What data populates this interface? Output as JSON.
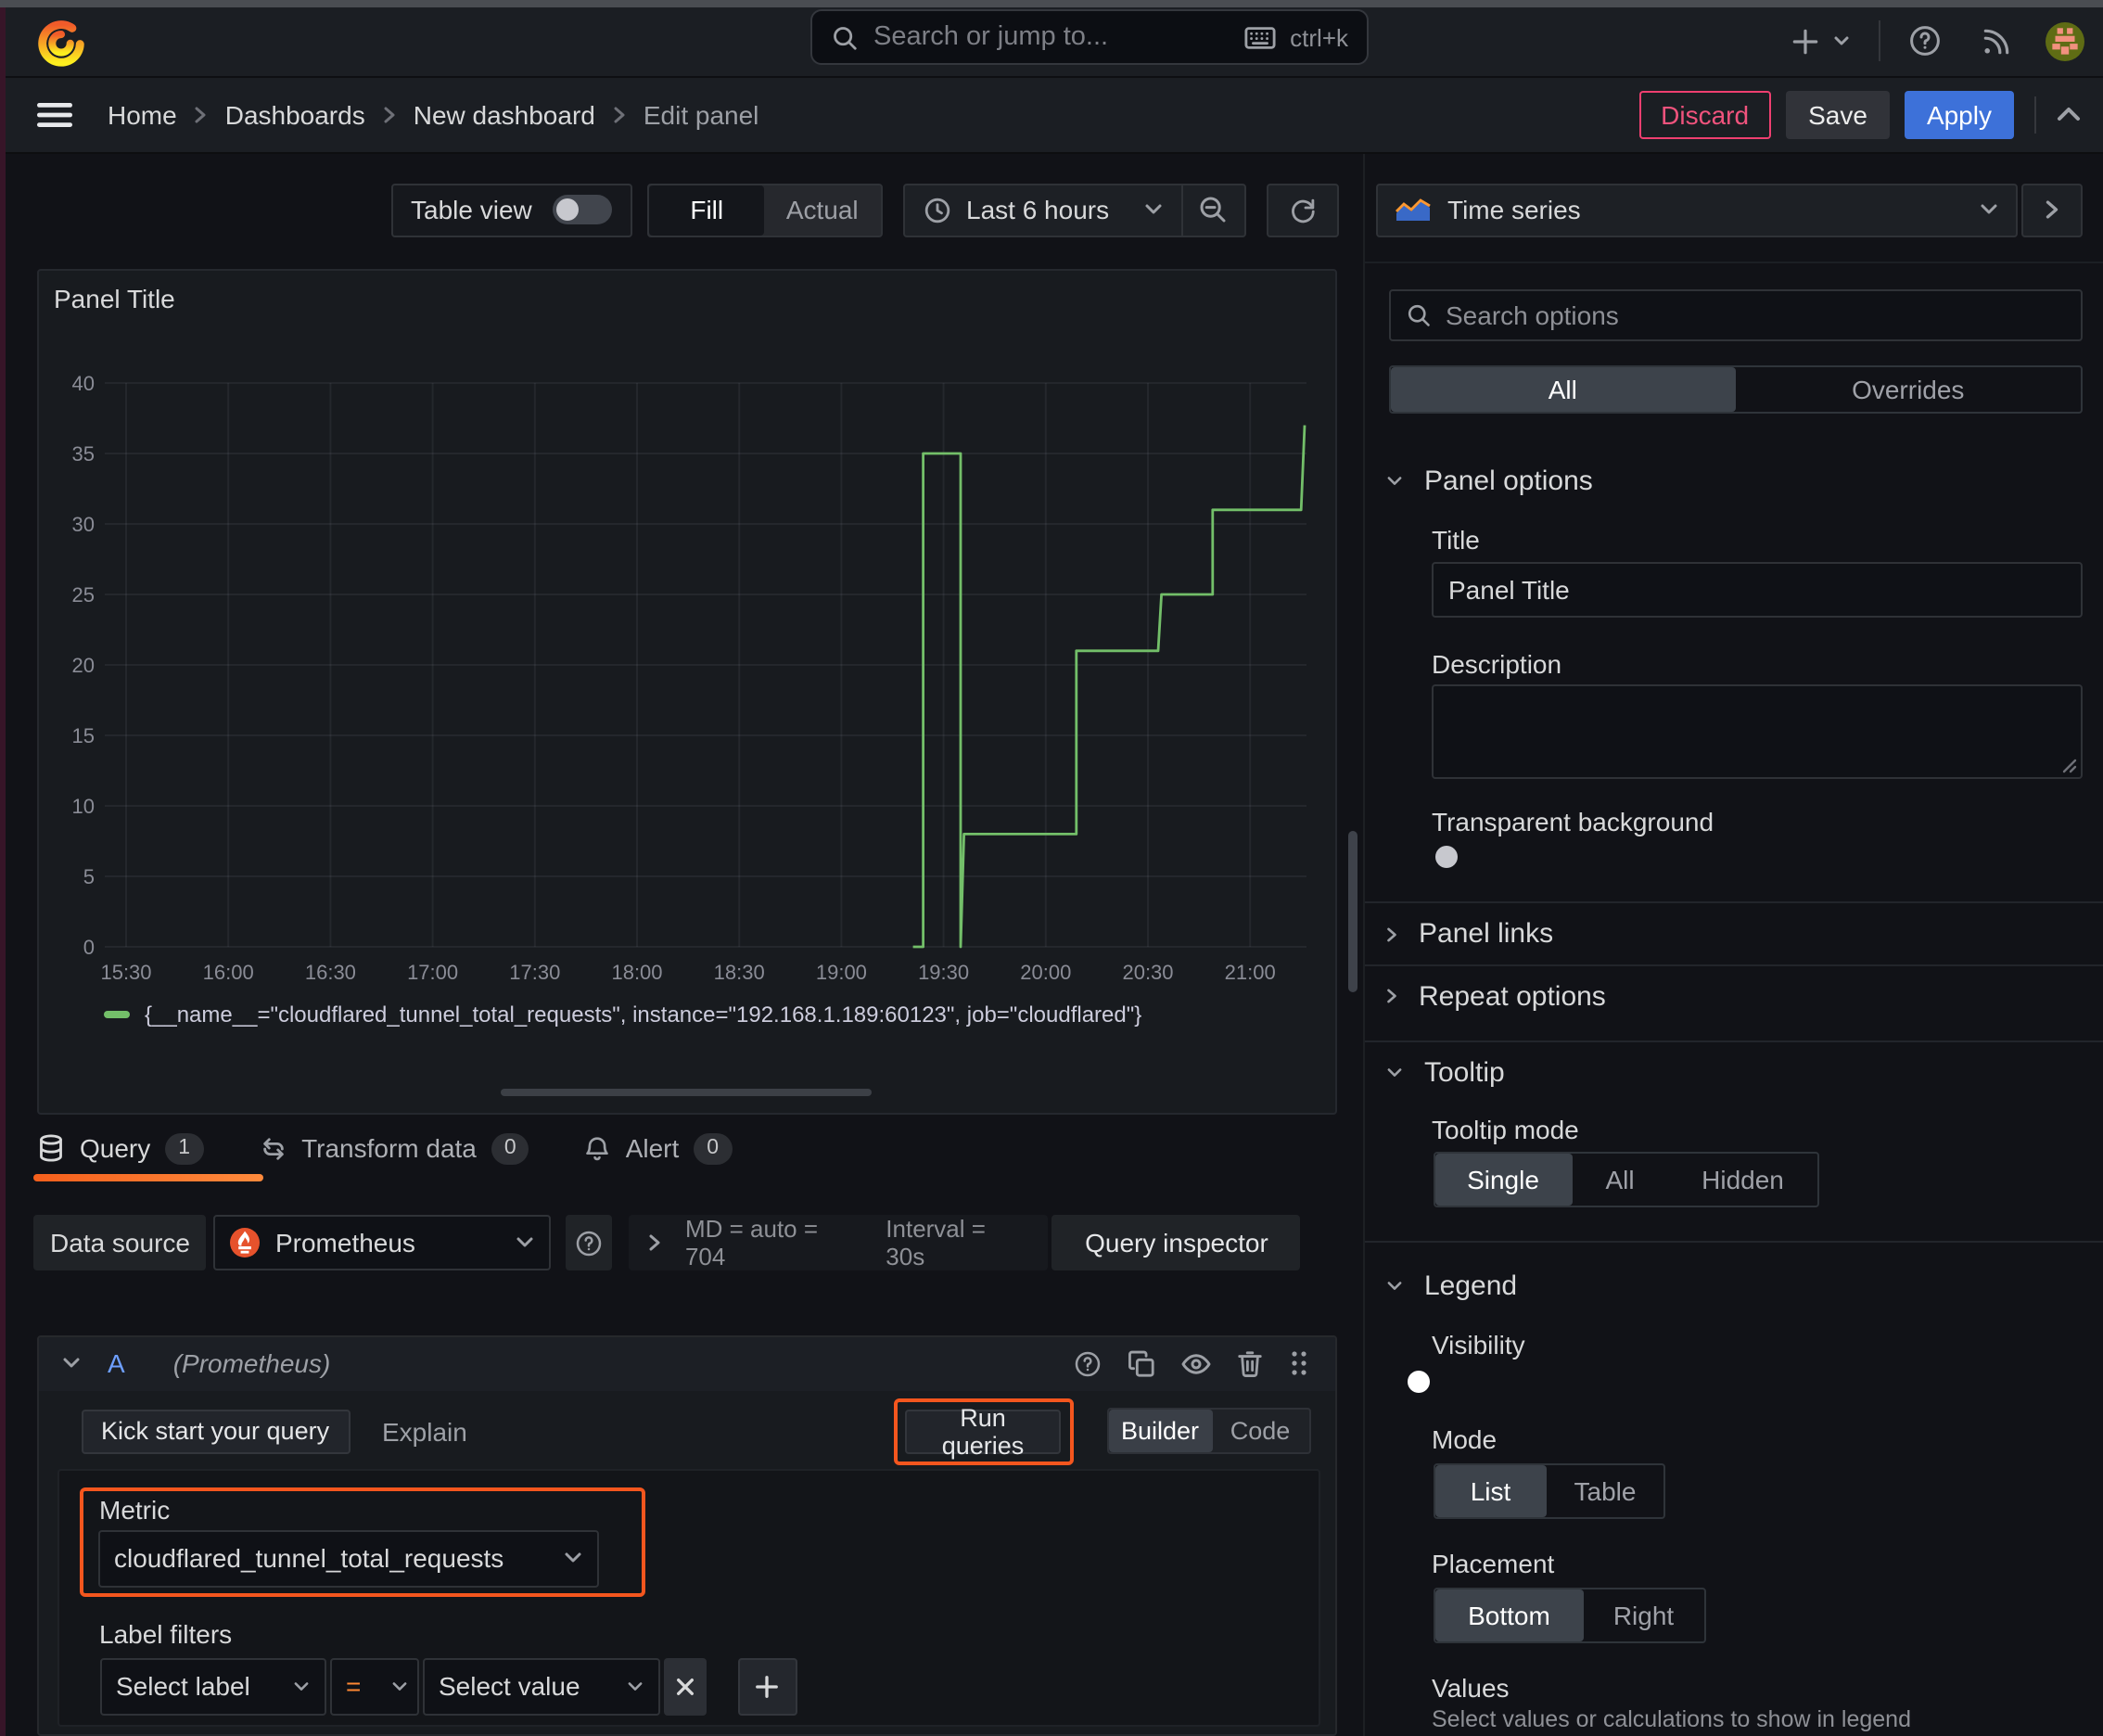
{
  "topbar": {
    "search_placeholder": "Search or jump to...",
    "search_shortcut": "ctrl+k"
  },
  "breadcrumb": {
    "items": [
      "Home",
      "Dashboards",
      "New dashboard",
      "Edit panel"
    ]
  },
  "actions": {
    "discard": "Discard",
    "save": "Save",
    "apply": "Apply"
  },
  "toolbar": {
    "table_view_label": "Table view",
    "fill_label": "Fill",
    "actual_label": "Actual",
    "time_range": "Last 6 hours"
  },
  "panel": {
    "title": "Panel Title"
  },
  "chart_data": {
    "type": "line",
    "title": "Panel Title",
    "xlabel": "",
    "ylabel": "",
    "ylim": [
      0,
      40
    ],
    "grid": true,
    "legend_position": "bottom",
    "x_ticks": [
      "15:30",
      "16:00",
      "16:30",
      "17:00",
      "17:30",
      "18:00",
      "18:30",
      "19:00",
      "19:30",
      "20:00",
      "20:30",
      "21:00"
    ],
    "y_ticks": [
      0,
      5,
      10,
      15,
      20,
      25,
      30,
      35,
      40
    ],
    "series": [
      {
        "name": "{__name__=\"cloudflared_tunnel_total_requests\", instance=\"192.168.1.189:60123\", job=\"cloudflared\"}",
        "color": "#73bf69",
        "points": [
          [
            "19:21",
            0
          ],
          [
            "19:24",
            0
          ],
          [
            "19:24",
            35
          ],
          [
            "19:35",
            35
          ],
          [
            "19:35",
            0
          ],
          [
            "19:36",
            8
          ],
          [
            "20:09",
            8
          ],
          [
            "20:09",
            21
          ],
          [
            "20:33",
            21
          ],
          [
            "20:34",
            25
          ],
          [
            "20:49",
            25
          ],
          [
            "20:49",
            31
          ],
          [
            "21:15",
            31
          ],
          [
            "21:16",
            37
          ]
        ]
      }
    ]
  },
  "tabs": {
    "query": {
      "label": "Query",
      "count": "1"
    },
    "transform": {
      "label": "Transform data",
      "count": "0"
    },
    "alert": {
      "label": "Alert",
      "count": "0"
    }
  },
  "datasource": {
    "label": "Data source",
    "name": "Prometheus",
    "max_data_points": "MD = auto = 704",
    "interval": "Interval = 30s",
    "inspector": "Query inspector"
  },
  "query": {
    "ref_id": "A",
    "datasource_hint": "(Prometheus)",
    "kickstart": "Kick start your query",
    "explain": "Explain",
    "run": "Run queries",
    "builder": "Builder",
    "code": "Code",
    "metric_label": "Metric",
    "metric_value": "cloudflared_tunnel_total_requests",
    "label_filters": "Label filters",
    "select_label": "Select label",
    "operator": "=",
    "select_value": "Select value"
  },
  "options": {
    "viz_type": "Time series",
    "search_placeholder": "Search options",
    "tab_all": "All",
    "tab_overrides": "Overrides",
    "panel_options": {
      "heading": "Panel options",
      "title_label": "Title",
      "title_value": "Panel Title",
      "description_label": "Description",
      "transparent_label": "Transparent background"
    },
    "panel_links": "Panel links",
    "repeat_options": "Repeat options",
    "tooltip": {
      "heading": "Tooltip",
      "mode_label": "Tooltip mode",
      "modes": [
        "Single",
        "All",
        "Hidden"
      ],
      "selected": "Single"
    },
    "legend": {
      "heading": "Legend",
      "visibility_label": "Visibility",
      "mode_label": "Mode",
      "modes": [
        "List",
        "Table"
      ],
      "selected_mode": "List",
      "placement_label": "Placement",
      "placements": [
        "Bottom",
        "Right"
      ],
      "selected_placement": "Bottom",
      "values_label": "Values",
      "values_hint": "Select values or calculations to show in legend"
    }
  },
  "colors": {
    "accent_blue": "#3d71d9",
    "series_green": "#73bf69",
    "annotation_orange": "#f4561e",
    "destructive_pink": "#ef3f70",
    "ref_id_blue": "#6e9fff",
    "operator_orange": "#ff8833"
  }
}
